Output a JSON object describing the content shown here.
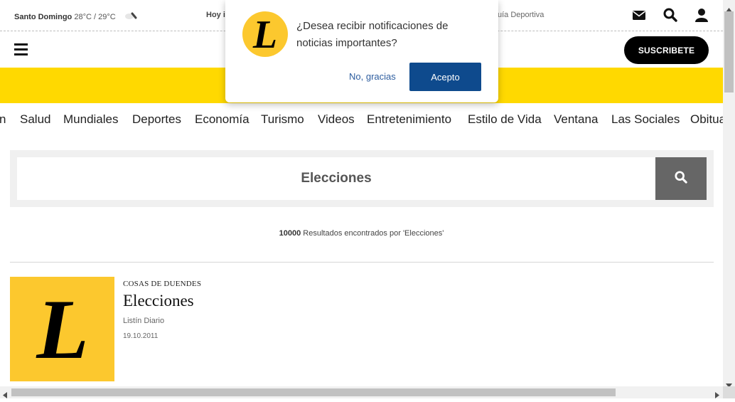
{
  "topbar": {
    "city": "Santo Domingo",
    "temperature": "28°C / 29°C",
    "today_label": "Hoy i",
    "guide_label": "uía Deportiva"
  },
  "header": {
    "subscribe_label": "SUSCRIBETE"
  },
  "nav": {
    "items": [
      "n",
      "Salud",
      "Mundiales",
      "Deportes",
      "Economía",
      "Turismo",
      "Videos",
      "Entretenimiento",
      "Estilo de Vida",
      "Ventana",
      "Las Sociales",
      "Obitua"
    ]
  },
  "search": {
    "query": "Elecciones"
  },
  "results": {
    "count": "10000",
    "text": "Resultados encontrados por 'Elecciones'"
  },
  "article": {
    "section": "COSAS DE DUENDES",
    "title": "Elecciones",
    "author": "Listín Diario",
    "date": "19.10.2011",
    "logo_letter": "L"
  },
  "popup": {
    "message": "¿Desea recibir notificaciones de noticias importantes?",
    "decline_label": "No, gracias",
    "accept_label": "Acepto",
    "logo_letter": "L"
  },
  "colors": {
    "brand_yellow": "#ffd900",
    "logo_yellow": "#fcc82e",
    "accept_blue": "#0e4a8d"
  },
  "icons": [
    "cloud-icon",
    "envelope-icon",
    "search-icon",
    "user-icon",
    "hamburger-icon",
    "scroll-arrow-icon"
  ]
}
